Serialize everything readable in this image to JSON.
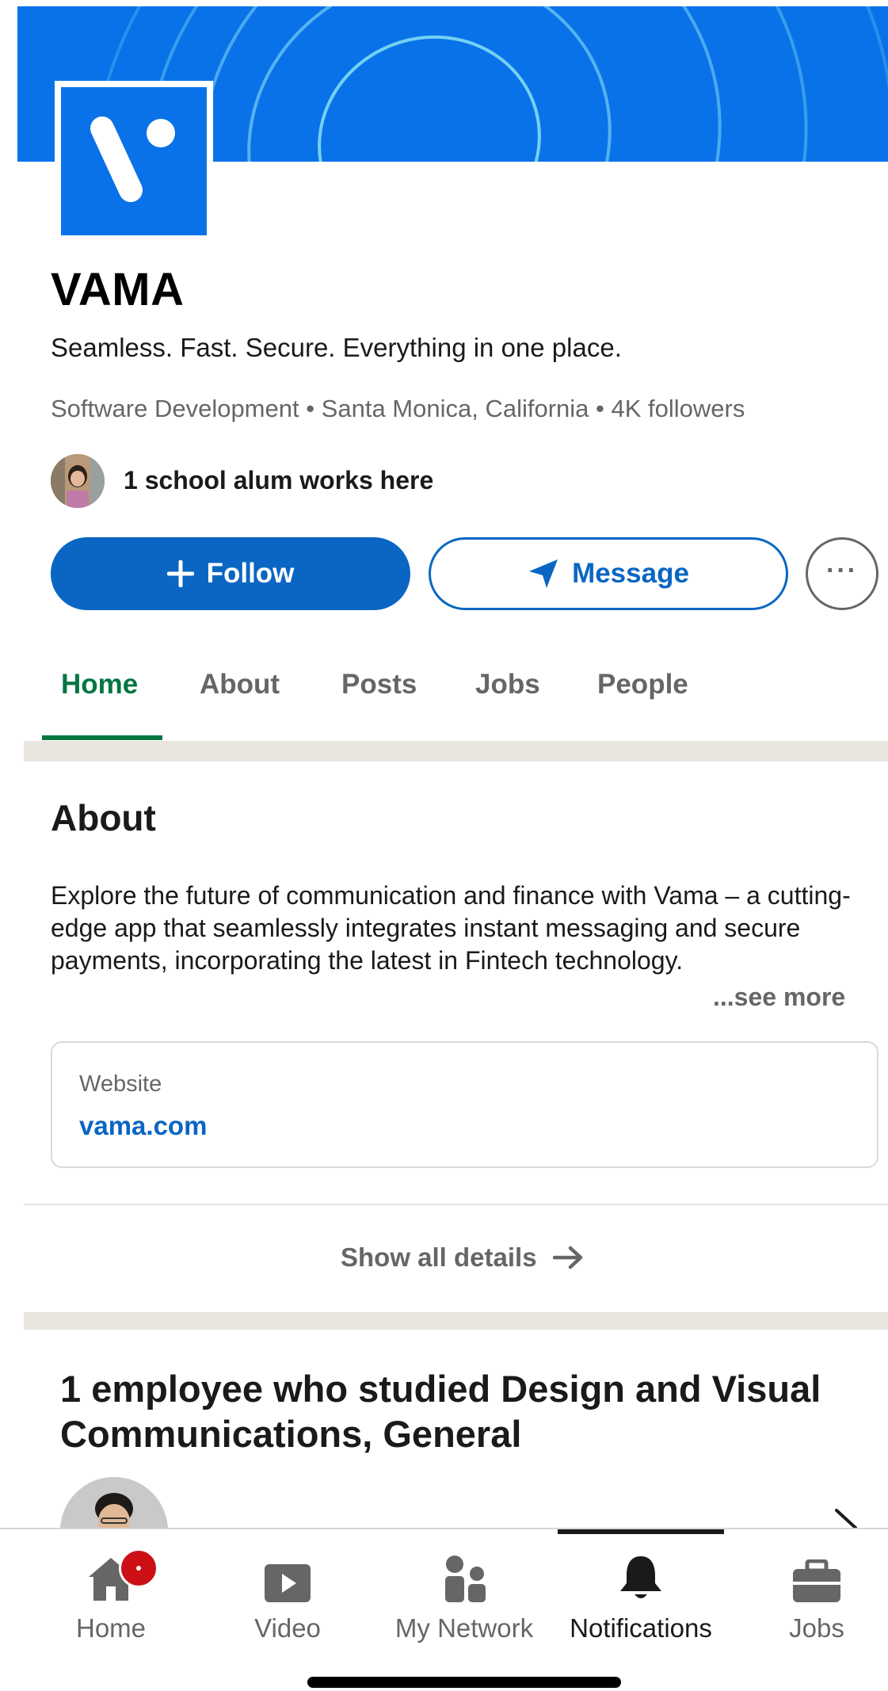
{
  "company": {
    "name": "VAMA",
    "tagline": "Seamless. Fast. Secure. Everything in one place.",
    "meta": "Software Development • Santa Monica, California • 4K followers",
    "alum_text": "1 school alum works here"
  },
  "actions": {
    "follow_label": "Follow",
    "message_label": "Message",
    "more_label": "···"
  },
  "tabs": [
    {
      "label": "Home",
      "active": true
    },
    {
      "label": "About"
    },
    {
      "label": "Posts"
    },
    {
      "label": "Jobs"
    },
    {
      "label": "People"
    }
  ],
  "about": {
    "heading": "About",
    "text": "Explore the future of communication and finance with Vama – a cutting-edge app that seamlessly integrates instant messaging and secure payments, incorporating the latest in Fintech technology.",
    "see_more": "...see more",
    "website_label": "Website",
    "website_url": "vama.com",
    "show_all": "Show all details"
  },
  "employees": {
    "heading": "1 employee who studied Design and Visual Communications, General"
  },
  "bottom_nav": [
    {
      "label": "Home",
      "icon": "home-icon",
      "badge": true
    },
    {
      "label": "Video",
      "icon": "video-icon"
    },
    {
      "label": "My Network",
      "icon": "network-icon"
    },
    {
      "label": "Notifications",
      "icon": "bell-icon",
      "active": true
    },
    {
      "label": "Jobs",
      "icon": "briefcase-icon"
    }
  ],
  "colors": {
    "brand_blue": "#0a72e8",
    "linkedin_blue": "#0a66c2",
    "active_green": "#057642",
    "badge_red": "#cc1016"
  }
}
